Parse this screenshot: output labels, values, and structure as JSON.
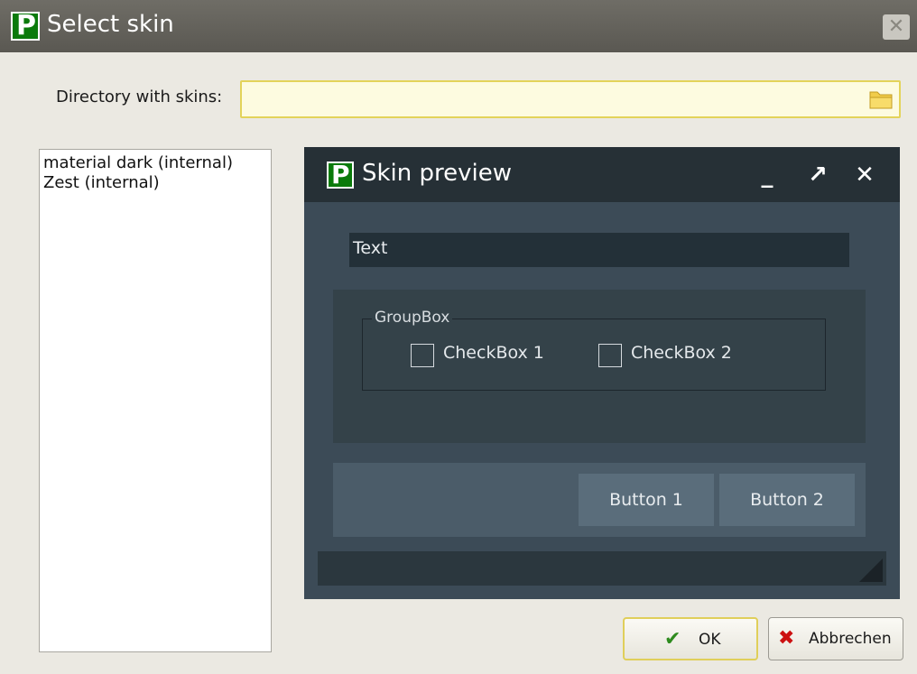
{
  "window": {
    "title": "Select skin"
  },
  "directory": {
    "label": "Directory with skins:",
    "value": ""
  },
  "skins": [
    "material dark (internal)",
    "Zest (internal)"
  ],
  "preview": {
    "title": "Skin preview",
    "minimize": "_",
    "maximize": "↗",
    "close": "✕",
    "text_value": "Text",
    "groupbox_title": "GroupBox",
    "checkbox1": "CheckBox 1",
    "checkbox2": "CheckBox 2",
    "button1": "Button 1",
    "button2": "Button 2"
  },
  "buttons": {
    "ok": "OK",
    "cancel": "Abbrechen"
  },
  "colors": {
    "ok_check": "#2e8b1e",
    "cancel_x": "#cc1111",
    "accent_yellow": "#e3d35a"
  },
  "icons": {
    "app": "p-logo-icon",
    "window_close": "close-icon",
    "folder": "folder-icon",
    "ok": "checkmark-icon",
    "cancel": "x-icon"
  }
}
